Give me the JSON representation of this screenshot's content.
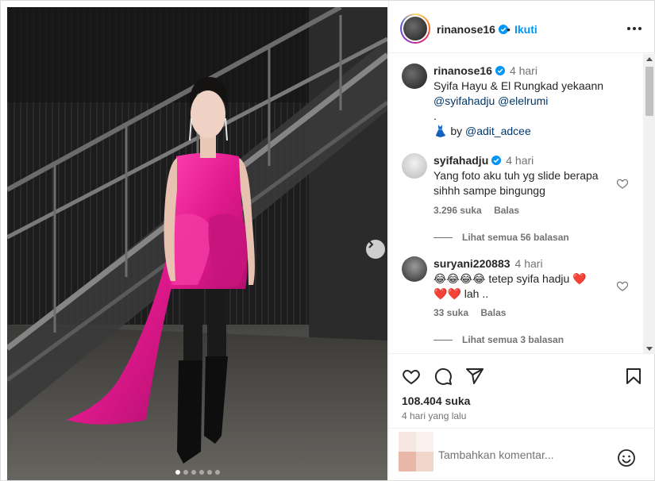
{
  "header": {
    "username": "rinanose16",
    "separator": "•",
    "follow_label": "Ikuti",
    "more_icon": "more-horizontal-icon"
  },
  "caption": {
    "username": "rinanose16",
    "time": "4 hari",
    "line1": "Syifa Hayu & El Rungkad yekaann",
    "mention1": "@syifahadju",
    "mention2": "@elelrumi",
    "line3": ".",
    "dress_emoji": "👗",
    "by_text": "by",
    "mention3": "@adit_adcee"
  },
  "comments": [
    {
      "username": "syifahadju",
      "verified": true,
      "time": "4 hari",
      "text": "Yang foto aku tuh yg slide berapa sihhh sampe bingungg",
      "likes": "3.296 suka",
      "reply_label": "Balas",
      "view_replies": "Lihat semua 56 balasan"
    },
    {
      "username": "suryani220883",
      "verified": false,
      "time": "4 hari",
      "emojis": "😂😂😂😂",
      "text_main": "tetep syifa hadju",
      "hearts": "❤️",
      "text_end": "lah ..",
      "likes": "33 suka",
      "reply_label": "Balas",
      "view_replies": "Lihat semua 3 balasan"
    }
  ],
  "post": {
    "likes_count": "108.404 suka",
    "time_ago": "4 hari yang lalu",
    "comment_placeholder": "Tambahkan komentar...",
    "carousel_total": 6,
    "carousel_active": 0
  },
  "colors": {
    "accent": "#0095f6",
    "mention": "#00376b",
    "dress": "#e0198c"
  }
}
